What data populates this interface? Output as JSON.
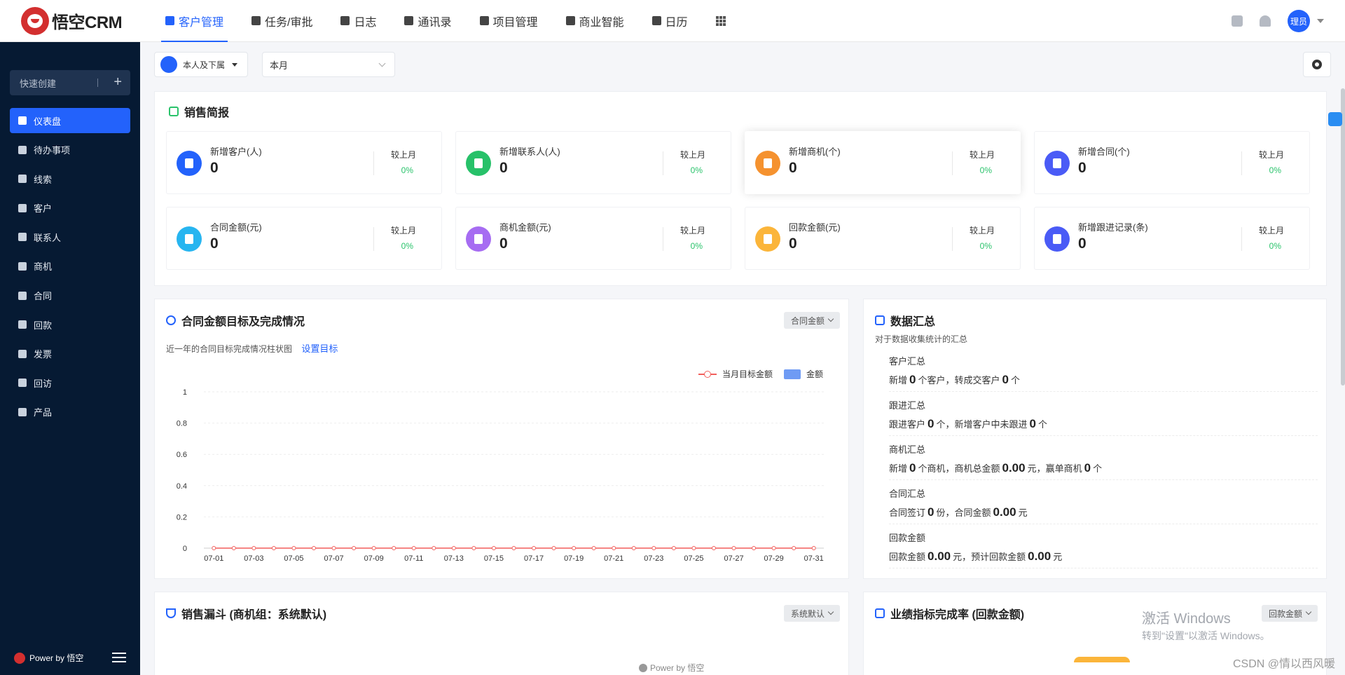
{
  "brand": {
    "name": "悟空CRM"
  },
  "nav": [
    {
      "label": "客户管理",
      "icon": "customer-icon",
      "active": true
    },
    {
      "label": "任务/审批",
      "icon": "briefcase-icon"
    },
    {
      "label": "日志",
      "icon": "log-icon"
    },
    {
      "label": "通讯录",
      "icon": "phone-icon"
    },
    {
      "label": "项目管理",
      "icon": "project-icon"
    },
    {
      "label": "商业智能",
      "icon": "bi-icon"
    },
    {
      "label": "日历",
      "icon": "calendar-icon"
    }
  ],
  "user": {
    "avatar_label": "理员"
  },
  "sidebar": {
    "quick_create": "快速创建",
    "items": [
      {
        "label": "仪表盘",
        "icon": "dashboard-icon",
        "active": true
      },
      {
        "label": "待办事项",
        "icon": "chat-icon"
      },
      {
        "label": "线索",
        "icon": "clue-icon"
      },
      {
        "label": "客户",
        "icon": "building-icon"
      },
      {
        "label": "联系人",
        "icon": "contact-icon"
      },
      {
        "label": "商机",
        "icon": "dollar-icon"
      },
      {
        "label": "合同",
        "icon": "contract-icon"
      },
      {
        "label": "回款",
        "icon": "moneybag-icon"
      },
      {
        "label": "发票",
        "icon": "invoice-icon"
      },
      {
        "label": "回访",
        "icon": "home-icon"
      },
      {
        "label": "产品",
        "icon": "box-icon"
      }
    ],
    "power": "Power by 悟空"
  },
  "filters": {
    "scope": "本人及下属",
    "period": "本月"
  },
  "sales_brief": {
    "title": "销售简报",
    "compare_label": "较上月",
    "kpis": [
      {
        "label": "新增客户(人)",
        "value": "0",
        "pct": "0%",
        "color": "#2362fb",
        "icon": "building-icon"
      },
      {
        "label": "新增联系人(人)",
        "value": "0",
        "pct": "0%",
        "color": "#27c169",
        "icon": "contact-icon"
      },
      {
        "label": "新增商机(个)",
        "value": "0",
        "pct": "0%",
        "color": "#f5922f",
        "icon": "dollar-icon"
      },
      {
        "label": "新增合同(个)",
        "value": "0",
        "pct": "0%",
        "color": "#4a5bf6",
        "icon": "contract-icon"
      },
      {
        "label": "合同金额(元)",
        "value": "0",
        "pct": "0%",
        "color": "#27b5f0",
        "icon": "moneybag-icon"
      },
      {
        "label": "商机金额(元)",
        "value": "0",
        "pct": "0%",
        "color": "#a66cf2",
        "icon": "shield-icon"
      },
      {
        "label": "回款金额(元)",
        "value": "0",
        "pct": "0%",
        "color": "#fbb53a",
        "icon": "moneybag-icon"
      },
      {
        "label": "新增跟进记录(条)",
        "value": "0",
        "pct": "0%",
        "color": "#4a5bf6",
        "icon": "clipboard-icon"
      }
    ]
  },
  "contract_target": {
    "title": "合同金额目标及完成情况",
    "chip": "合同金额",
    "subtitle": "近一年的合同目标完成情况柱状图",
    "link": "设置目标"
  },
  "chart_data": {
    "type": "bar",
    "categories": [
      "07-01",
      "07-02",
      "07-03",
      "07-04",
      "07-05",
      "07-06",
      "07-07",
      "07-08",
      "07-09",
      "07-10",
      "07-11",
      "07-12",
      "07-13",
      "07-14",
      "07-15",
      "07-16",
      "07-17",
      "07-18",
      "07-19",
      "07-20",
      "07-21",
      "07-22",
      "07-23",
      "07-24",
      "07-25",
      "07-26",
      "07-27",
      "07-28",
      "07-29",
      "07-30",
      "07-31"
    ],
    "x_tick_labels": [
      "07-01",
      "07-03",
      "07-05",
      "07-07",
      "07-09",
      "07-11",
      "07-13",
      "07-15",
      "07-17",
      "07-19",
      "07-21",
      "07-23",
      "07-25",
      "07-27",
      "07-29",
      "07-31"
    ],
    "y_ticks": [
      "0",
      "0.2",
      "0.4",
      "0.6",
      "0.8",
      "1"
    ],
    "ylim": [
      0,
      1
    ],
    "series": [
      {
        "name": "当月目标金额",
        "kind": "line",
        "color": "#f25f5c",
        "values": [
          0,
          0,
          0,
          0,
          0,
          0,
          0,
          0,
          0,
          0,
          0,
          0,
          0,
          0,
          0,
          0,
          0,
          0,
          0,
          0,
          0,
          0,
          0,
          0,
          0,
          0,
          0,
          0,
          0,
          0,
          0
        ]
      },
      {
        "name": "金额",
        "kind": "bar",
        "color": "#6f9bf4",
        "values": [
          0,
          0,
          0,
          0,
          0,
          0,
          0,
          0,
          0,
          0,
          0,
          0,
          0,
          0,
          0,
          0,
          0,
          0,
          0,
          0,
          0,
          0,
          0,
          0,
          0,
          0,
          0,
          0,
          0,
          0,
          0
        ]
      }
    ],
    "grid": true,
    "legend": "top-right"
  },
  "summary": {
    "title": "数据汇总",
    "desc": "对于数据收集统计的汇总",
    "blocks": [
      {
        "title": "客户汇总",
        "parts": [
          "新增",
          "0",
          "个客户，转成交客户",
          "0",
          "个"
        ]
      },
      {
        "title": "跟进汇总",
        "parts": [
          "跟进客户",
          "0",
          "个，新增客户中未跟进",
          "0",
          "个"
        ]
      },
      {
        "title": "商机汇总",
        "parts": [
          "新增",
          "0",
          "个商机，商机总金额",
          "0.00",
          "元，赢单商机",
          "0",
          "个"
        ]
      },
      {
        "title": "合同汇总",
        "parts": [
          "合同签订",
          "0",
          "份，合同金额",
          "0.00",
          "元"
        ]
      },
      {
        "title": "回款金额",
        "parts": [
          "回款金额",
          "0.00",
          "元，预计回款金额",
          "0.00",
          "元"
        ]
      }
    ]
  },
  "funnel": {
    "title": "销售漏斗 (商机组：系统默认)",
    "chip": "系统默认"
  },
  "performance": {
    "title": "业绩指标完成率 (回款金额)",
    "chip": "回款金额"
  },
  "watermark": {
    "line1": "激活 Windows",
    "line2": "转到\"设置\"以激活 Windows。"
  },
  "footer_power": "Power by 悟空",
  "csdn": "CSDN @情以西风暖"
}
